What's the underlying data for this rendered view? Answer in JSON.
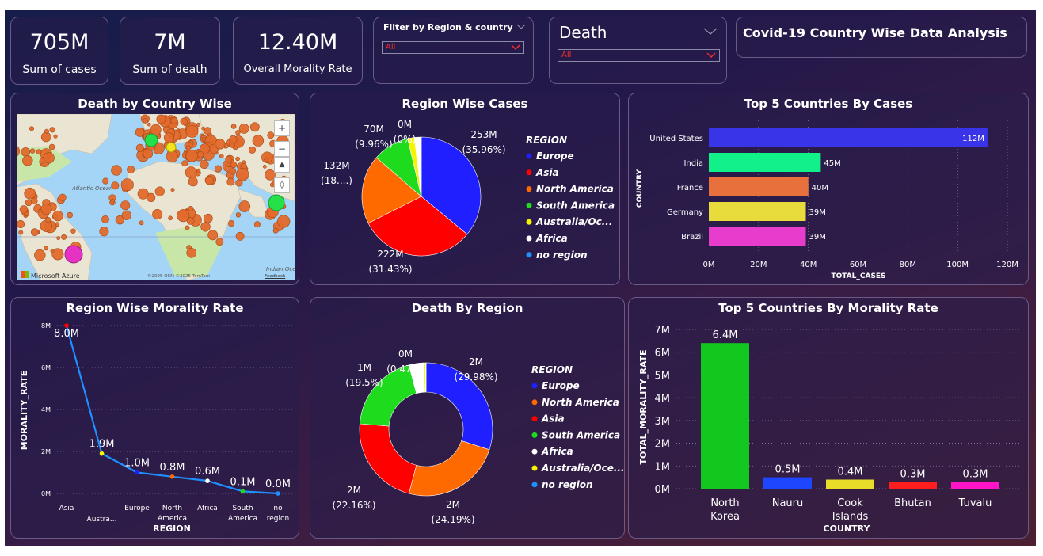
{
  "kpis": [
    {
      "value": "705M",
      "label": "Sum of cases"
    },
    {
      "value": "7M",
      "label": "Sum of death"
    },
    {
      "value": "12.40M",
      "label": "Overall Morality Rate"
    }
  ],
  "slicer_region": {
    "title": "Filter by Region & country",
    "value": "All"
  },
  "slicer_death": {
    "title": "Death",
    "value": "All"
  },
  "dashboard_title": "Covid-19 Country Wise Data Analysis",
  "map": {
    "title": "Death by Country Wise",
    "ocean_label_1": "Atlantic Ocean",
    "ocean_label_2": "Indian Ocean",
    "attribution": "Microsoft Azure",
    "copyright": "©2025 OSM ©2025 TomTom",
    "feedback": "Feedback",
    "zoom_in": "+",
    "zoom_out": "−"
  },
  "region_cases": {
    "title": "Region Wise Cases",
    "legend_title": "REGION",
    "labels": [
      {
        "value": "253M",
        "pct": "(35.96%)"
      },
      {
        "value": "222M",
        "pct": "(31.43%)"
      },
      {
        "value": "132M",
        "pct": "(18....)"
      },
      {
        "value": "70M",
        "pct": "(9.96%)"
      },
      {
        "value": "0M",
        "pct": "(0%)"
      }
    ]
  },
  "top5_cases": {
    "title": "Top 5 Countries By Cases"
  },
  "morality_region": {
    "title": "Region Wise Morality Rate"
  },
  "death_region": {
    "title": "Death By Region",
    "legend_title": "REGION",
    "labels": [
      {
        "value": "2M",
        "pct": "(29.98%)"
      },
      {
        "value": "2M",
        "pct": "(24.19%)"
      },
      {
        "value": "2M",
        "pct": "(22.16%)"
      },
      {
        "value": "1M",
        "pct": "(19.5%)"
      },
      {
        "value": "0M",
        "pct": "(0.47%)"
      }
    ]
  },
  "top5_morality": {
    "title": "Top 5 Countries By Morality Rate"
  },
  "chart_data": [
    {
      "type": "pie",
      "title": "Region Wise Cases",
      "legend_title": "REGION",
      "categories": [
        "Europe",
        "Asia",
        "North America",
        "South America",
        "Australia/Oc...",
        "Africa",
        "no region"
      ],
      "values": [
        253,
        222,
        132,
        70,
        13,
        13,
        0
      ],
      "colors": [
        "#1f1fff",
        "#ff0000",
        "#ff6a00",
        "#1edb1e",
        "#f5f500",
        "#ffffff",
        "#1e90ff"
      ],
      "legend_position": "right"
    },
    {
      "type": "bar",
      "title": "Top 5 Countries By Cases",
      "orientation": "horizontal",
      "categories": [
        "United States",
        "India",
        "France",
        "Germany",
        "Brazil"
      ],
      "values": [
        112,
        45,
        40,
        39,
        39
      ],
      "data_labels": [
        "112M",
        "45M",
        "40M",
        "39M",
        "39M"
      ],
      "colors": [
        "#3a34e8",
        "#12f08a",
        "#e8703c",
        "#e8dc3c",
        "#e83ccc"
      ],
      "xlabel": "TOTAL_CASES",
      "ylabel": "COUNTRY",
      "x_ticks": [
        "0M",
        "20M",
        "40M",
        "60M",
        "80M",
        "100M",
        "120M"
      ],
      "xlim": [
        0,
        120
      ]
    },
    {
      "type": "line",
      "title": "Region Wise Morality Rate",
      "categories": [
        "Asia",
        "Austra...",
        "Europe",
        "North America",
        "Africa",
        "South America",
        "no region"
      ],
      "values": [
        8.0,
        1.9,
        1.0,
        0.8,
        0.6,
        0.1,
        0.0
      ],
      "data_labels": [
        "8.0M",
        "1.9M",
        "1.0M",
        "0.8M",
        "0.6M",
        "0.1M",
        "0.0M"
      ],
      "point_colors": [
        "#ff0000",
        "#f5f500",
        "#1f1fff",
        "#ff6a00",
        "#ffffff",
        "#1edb1e",
        "#1e90ff"
      ],
      "line_color": "#1e90ff",
      "xlabel": "REGION",
      "ylabel": "MORALITY_RATE",
      "y_ticks": [
        "0M",
        "2M",
        "4M",
        "6M",
        "8M"
      ],
      "ylim": [
        0,
        8
      ]
    },
    {
      "type": "pie",
      "title": "Death By Region",
      "donut": true,
      "legend_title": "REGION",
      "categories": [
        "Europe",
        "North America",
        "Asia",
        "South America",
        "Africa",
        "Australia/Oce...",
        "no region"
      ],
      "values": [
        29.98,
        24.19,
        22.16,
        19.5,
        3.6,
        0.47,
        0.1
      ],
      "colors": [
        "#1f1fff",
        "#ff6a00",
        "#ff0000",
        "#1edb1e",
        "#ffffff",
        "#f5f500",
        "#1e90ff"
      ],
      "legend_position": "right"
    },
    {
      "type": "bar",
      "title": "Top 5 Countries By Morality Rate",
      "categories": [
        "North Korea",
        "Nauru",
        "Cook Islands",
        "Bhutan",
        "Tuvalu"
      ],
      "values": [
        6.4,
        0.5,
        0.4,
        0.3,
        0.3
      ],
      "data_labels": [
        "6.4M",
        "0.5M",
        "0.4M",
        "0.3M",
        "0.3M"
      ],
      "colors": [
        "#12c81e",
        "#1e46ff",
        "#e8dc28",
        "#ff1e1e",
        "#ff14c8"
      ],
      "xlabel": "COUNTRY",
      "ylabel": "TOTAL_MORALITY_RATE",
      "y_ticks": [
        "0M",
        "1M",
        "2M",
        "3M",
        "4M",
        "5M",
        "6M",
        "7M"
      ],
      "ylim": [
        0,
        7
      ]
    }
  ]
}
